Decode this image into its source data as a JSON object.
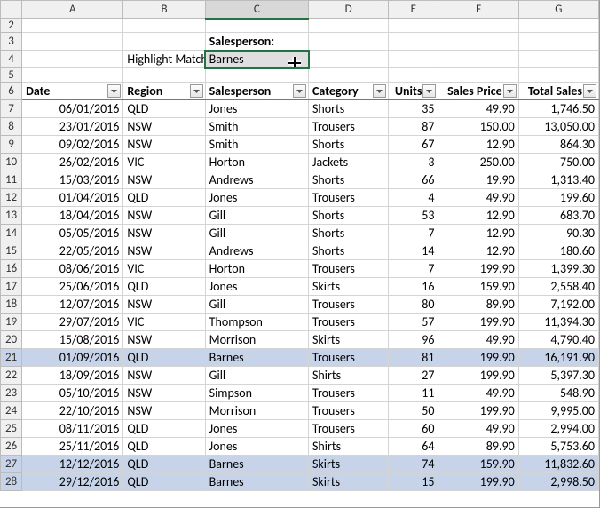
{
  "columns": [
    "A",
    "B",
    "C",
    "D",
    "E",
    "F",
    "G"
  ],
  "labels": {
    "salesperson_prompt": "Salesperson:",
    "highlight_matches": "Highlight Matches"
  },
  "dropdown": {
    "selected": "Barnes"
  },
  "headers": {
    "date": "Date",
    "region": "Region",
    "salesperson": "Salesperson",
    "category": "Category",
    "units": "Units",
    "sales_price": "Sales Price",
    "total_sales": "Total Sales"
  },
  "highlight_match": "Barnes",
  "rows": [
    {
      "n": 7,
      "date": "06/01/2016",
      "region": "QLD",
      "sp": "Jones",
      "cat": "Shorts",
      "units": "35",
      "price": "49.90",
      "total": "1,746.50"
    },
    {
      "n": 8,
      "date": "23/01/2016",
      "region": "NSW",
      "sp": "Smith",
      "cat": "Trousers",
      "units": "87",
      "price": "150.00",
      "total": "13,050.00"
    },
    {
      "n": 9,
      "date": "09/02/2016",
      "region": "NSW",
      "sp": "Smith",
      "cat": "Shorts",
      "units": "67",
      "price": "12.90",
      "total": "864.30"
    },
    {
      "n": 10,
      "date": "26/02/2016",
      "region": "VIC",
      "sp": "Horton",
      "cat": "Jackets",
      "units": "3",
      "price": "250.00",
      "total": "750.00"
    },
    {
      "n": 11,
      "date": "15/03/2016",
      "region": "NSW",
      "sp": "Andrews",
      "cat": "Shorts",
      "units": "66",
      "price": "19.90",
      "total": "1,313.40"
    },
    {
      "n": 12,
      "date": "01/04/2016",
      "region": "QLD",
      "sp": "Jones",
      "cat": "Trousers",
      "units": "4",
      "price": "49.90",
      "total": "199.60"
    },
    {
      "n": 13,
      "date": "18/04/2016",
      "region": "NSW",
      "sp": "Gill",
      "cat": "Shorts",
      "units": "53",
      "price": "12.90",
      "total": "683.70"
    },
    {
      "n": 14,
      "date": "05/05/2016",
      "region": "NSW",
      "sp": "Gill",
      "cat": "Shorts",
      "units": "7",
      "price": "12.90",
      "total": "90.30"
    },
    {
      "n": 15,
      "date": "22/05/2016",
      "region": "NSW",
      "sp": "Andrews",
      "cat": "Shorts",
      "units": "14",
      "price": "12.90",
      "total": "180.60"
    },
    {
      "n": 16,
      "date": "08/06/2016",
      "region": "VIC",
      "sp": "Horton",
      "cat": "Trousers",
      "units": "7",
      "price": "199.90",
      "total": "1,399.30"
    },
    {
      "n": 17,
      "date": "25/06/2016",
      "region": "QLD",
      "sp": "Jones",
      "cat": "Skirts",
      "units": "16",
      "price": "159.90",
      "total": "2,558.40"
    },
    {
      "n": 18,
      "date": "12/07/2016",
      "region": "NSW",
      "sp": "Gill",
      "cat": "Trousers",
      "units": "80",
      "price": "89.90",
      "total": "7,192.00"
    },
    {
      "n": 19,
      "date": "29/07/2016",
      "region": "VIC",
      "sp": "Thompson",
      "cat": "Trousers",
      "units": "57",
      "price": "199.90",
      "total": "11,394.30"
    },
    {
      "n": 20,
      "date": "15/08/2016",
      "region": "NSW",
      "sp": "Morrison",
      "cat": "Skirts",
      "units": "96",
      "price": "49.90",
      "total": "4,790.40"
    },
    {
      "n": 21,
      "date": "01/09/2016",
      "region": "QLD",
      "sp": "Barnes",
      "cat": "Trousers",
      "units": "81",
      "price": "199.90",
      "total": "16,191.90"
    },
    {
      "n": 22,
      "date": "18/09/2016",
      "region": "NSW",
      "sp": "Gill",
      "cat": "Shirts",
      "units": "27",
      "price": "199.90",
      "total": "5,397.30"
    },
    {
      "n": 23,
      "date": "05/10/2016",
      "region": "NSW",
      "sp": "Simpson",
      "cat": "Trousers",
      "units": "11",
      "price": "49.90",
      "total": "548.90"
    },
    {
      "n": 24,
      "date": "22/10/2016",
      "region": "NSW",
      "sp": "Morrison",
      "cat": "Trousers",
      "units": "50",
      "price": "199.90",
      "total": "9,995.00"
    },
    {
      "n": 25,
      "date": "08/11/2016",
      "region": "QLD",
      "sp": "Jones",
      "cat": "Trousers",
      "units": "60",
      "price": "49.90",
      "total": "2,994.00"
    },
    {
      "n": 26,
      "date": "25/11/2016",
      "region": "QLD",
      "sp": "Jones",
      "cat": "Shirts",
      "units": "64",
      "price": "89.90",
      "total": "5,753.60"
    },
    {
      "n": 27,
      "date": "12/12/2016",
      "region": "QLD",
      "sp": "Barnes",
      "cat": "Skirts",
      "units": "74",
      "price": "159.90",
      "total": "11,832.60"
    },
    {
      "n": 28,
      "date": "29/12/2016",
      "region": "QLD",
      "sp": "Barnes",
      "cat": "Skirts",
      "units": "15",
      "price": "199.90",
      "total": "2,998.50"
    }
  ]
}
